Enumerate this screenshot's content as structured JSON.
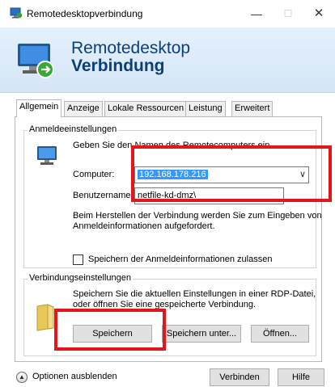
{
  "window": {
    "title": "Remotedesktopverbindung",
    "minimize_glyph": "—",
    "maximize_glyph": "☐",
    "close_glyph": "✕"
  },
  "banner": {
    "line1": "Remotedesktop",
    "line2": "Verbindung",
    "icon": "remote-desktop-monitor-icon"
  },
  "tabs": [
    {
      "label": "Allgemein",
      "active": true
    },
    {
      "label": "Anzeige",
      "active": false
    },
    {
      "label": "Lokale Ressourcen",
      "active": false
    },
    {
      "label": "Leistung",
      "active": false
    },
    {
      "label": "Erweitert",
      "active": false
    }
  ],
  "logon": {
    "legend": "Anmeldeeinstellungen",
    "instruction": "Geben Sie den Namen des Remotecomputers ein.",
    "computer_label": "Computer:",
    "computer_value": "192.168.178.216",
    "username_label": "Benutzername",
    "username_value": "netfile-kd-dmz\\",
    "info_line1": "Beim Herstellen der Verbindung werden Sie zum Eingeben von",
    "info_line2": "Anmeldeinformationen aufgefordert.",
    "save_credentials_label": "Speichern der Anmeldeinformationen zulassen",
    "save_credentials_checked": false
  },
  "connection": {
    "legend": "Verbindungseinstellungen",
    "text_line1": "Speichern Sie die aktuellen Einstellungen in einer RDP-Datei,",
    "text_line2": "oder öffnen Sie eine gespeicherte Verbindung.",
    "save_button": "Speichern",
    "save_as_button": "Speichern unter...",
    "open_button": "Öffnen..."
  },
  "footer": {
    "options_label": "Optionen ausblenden",
    "connect_button": "Verbinden",
    "help_button": "Hilfe"
  },
  "colors": {
    "highlight": "#e3161b",
    "selection": "#3399ff",
    "banner_text": "#0b3e7a"
  }
}
